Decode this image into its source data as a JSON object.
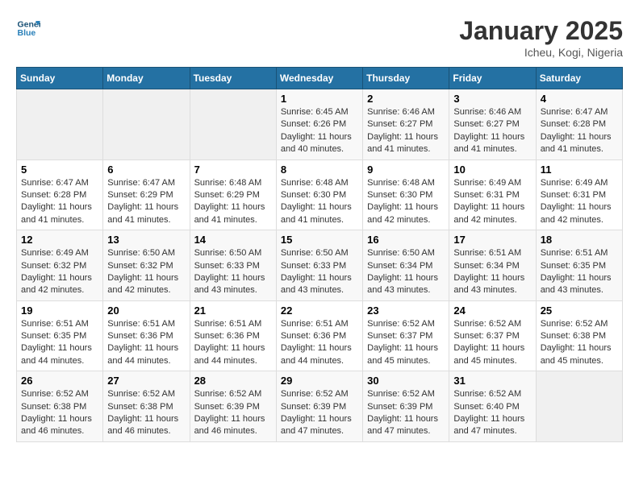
{
  "header": {
    "logo_line1": "General",
    "logo_line2": "Blue",
    "month_title": "January 2025",
    "location": "Icheu, Kogi, Nigeria"
  },
  "days_of_week": [
    "Sunday",
    "Monday",
    "Tuesday",
    "Wednesday",
    "Thursday",
    "Friday",
    "Saturday"
  ],
  "weeks": [
    [
      {
        "day": "",
        "sunrise": "",
        "sunset": "",
        "daylight": ""
      },
      {
        "day": "",
        "sunrise": "",
        "sunset": "",
        "daylight": ""
      },
      {
        "day": "",
        "sunrise": "",
        "sunset": "",
        "daylight": ""
      },
      {
        "day": "1",
        "sunrise": "Sunrise: 6:45 AM",
        "sunset": "Sunset: 6:26 PM",
        "daylight": "Daylight: 11 hours and 40 minutes."
      },
      {
        "day": "2",
        "sunrise": "Sunrise: 6:46 AM",
        "sunset": "Sunset: 6:27 PM",
        "daylight": "Daylight: 11 hours and 41 minutes."
      },
      {
        "day": "3",
        "sunrise": "Sunrise: 6:46 AM",
        "sunset": "Sunset: 6:27 PM",
        "daylight": "Daylight: 11 hours and 41 minutes."
      },
      {
        "day": "4",
        "sunrise": "Sunrise: 6:47 AM",
        "sunset": "Sunset: 6:28 PM",
        "daylight": "Daylight: 11 hours and 41 minutes."
      }
    ],
    [
      {
        "day": "5",
        "sunrise": "Sunrise: 6:47 AM",
        "sunset": "Sunset: 6:28 PM",
        "daylight": "Daylight: 11 hours and 41 minutes."
      },
      {
        "day": "6",
        "sunrise": "Sunrise: 6:47 AM",
        "sunset": "Sunset: 6:29 PM",
        "daylight": "Daylight: 11 hours and 41 minutes."
      },
      {
        "day": "7",
        "sunrise": "Sunrise: 6:48 AM",
        "sunset": "Sunset: 6:29 PM",
        "daylight": "Daylight: 11 hours and 41 minutes."
      },
      {
        "day": "8",
        "sunrise": "Sunrise: 6:48 AM",
        "sunset": "Sunset: 6:30 PM",
        "daylight": "Daylight: 11 hours and 41 minutes."
      },
      {
        "day": "9",
        "sunrise": "Sunrise: 6:48 AM",
        "sunset": "Sunset: 6:30 PM",
        "daylight": "Daylight: 11 hours and 42 minutes."
      },
      {
        "day": "10",
        "sunrise": "Sunrise: 6:49 AM",
        "sunset": "Sunset: 6:31 PM",
        "daylight": "Daylight: 11 hours and 42 minutes."
      },
      {
        "day": "11",
        "sunrise": "Sunrise: 6:49 AM",
        "sunset": "Sunset: 6:31 PM",
        "daylight": "Daylight: 11 hours and 42 minutes."
      }
    ],
    [
      {
        "day": "12",
        "sunrise": "Sunrise: 6:49 AM",
        "sunset": "Sunset: 6:32 PM",
        "daylight": "Daylight: 11 hours and 42 minutes."
      },
      {
        "day": "13",
        "sunrise": "Sunrise: 6:50 AM",
        "sunset": "Sunset: 6:32 PM",
        "daylight": "Daylight: 11 hours and 42 minutes."
      },
      {
        "day": "14",
        "sunrise": "Sunrise: 6:50 AM",
        "sunset": "Sunset: 6:33 PM",
        "daylight": "Daylight: 11 hours and 43 minutes."
      },
      {
        "day": "15",
        "sunrise": "Sunrise: 6:50 AM",
        "sunset": "Sunset: 6:33 PM",
        "daylight": "Daylight: 11 hours and 43 minutes."
      },
      {
        "day": "16",
        "sunrise": "Sunrise: 6:50 AM",
        "sunset": "Sunset: 6:34 PM",
        "daylight": "Daylight: 11 hours and 43 minutes."
      },
      {
        "day": "17",
        "sunrise": "Sunrise: 6:51 AM",
        "sunset": "Sunset: 6:34 PM",
        "daylight": "Daylight: 11 hours and 43 minutes."
      },
      {
        "day": "18",
        "sunrise": "Sunrise: 6:51 AM",
        "sunset": "Sunset: 6:35 PM",
        "daylight": "Daylight: 11 hours and 43 minutes."
      }
    ],
    [
      {
        "day": "19",
        "sunrise": "Sunrise: 6:51 AM",
        "sunset": "Sunset: 6:35 PM",
        "daylight": "Daylight: 11 hours and 44 minutes."
      },
      {
        "day": "20",
        "sunrise": "Sunrise: 6:51 AM",
        "sunset": "Sunset: 6:36 PM",
        "daylight": "Daylight: 11 hours and 44 minutes."
      },
      {
        "day": "21",
        "sunrise": "Sunrise: 6:51 AM",
        "sunset": "Sunset: 6:36 PM",
        "daylight": "Daylight: 11 hours and 44 minutes."
      },
      {
        "day": "22",
        "sunrise": "Sunrise: 6:51 AM",
        "sunset": "Sunset: 6:36 PM",
        "daylight": "Daylight: 11 hours and 44 minutes."
      },
      {
        "day": "23",
        "sunrise": "Sunrise: 6:52 AM",
        "sunset": "Sunset: 6:37 PM",
        "daylight": "Daylight: 11 hours and 45 minutes."
      },
      {
        "day": "24",
        "sunrise": "Sunrise: 6:52 AM",
        "sunset": "Sunset: 6:37 PM",
        "daylight": "Daylight: 11 hours and 45 minutes."
      },
      {
        "day": "25",
        "sunrise": "Sunrise: 6:52 AM",
        "sunset": "Sunset: 6:38 PM",
        "daylight": "Daylight: 11 hours and 45 minutes."
      }
    ],
    [
      {
        "day": "26",
        "sunrise": "Sunrise: 6:52 AM",
        "sunset": "Sunset: 6:38 PM",
        "daylight": "Daylight: 11 hours and 46 minutes."
      },
      {
        "day": "27",
        "sunrise": "Sunrise: 6:52 AM",
        "sunset": "Sunset: 6:38 PM",
        "daylight": "Daylight: 11 hours and 46 minutes."
      },
      {
        "day": "28",
        "sunrise": "Sunrise: 6:52 AM",
        "sunset": "Sunset: 6:39 PM",
        "daylight": "Daylight: 11 hours and 46 minutes."
      },
      {
        "day": "29",
        "sunrise": "Sunrise: 6:52 AM",
        "sunset": "Sunset: 6:39 PM",
        "daylight": "Daylight: 11 hours and 47 minutes."
      },
      {
        "day": "30",
        "sunrise": "Sunrise: 6:52 AM",
        "sunset": "Sunset: 6:39 PM",
        "daylight": "Daylight: 11 hours and 47 minutes."
      },
      {
        "day": "31",
        "sunrise": "Sunrise: 6:52 AM",
        "sunset": "Sunset: 6:40 PM",
        "daylight": "Daylight: 11 hours and 47 minutes."
      },
      {
        "day": "",
        "sunrise": "",
        "sunset": "",
        "daylight": ""
      }
    ]
  ]
}
